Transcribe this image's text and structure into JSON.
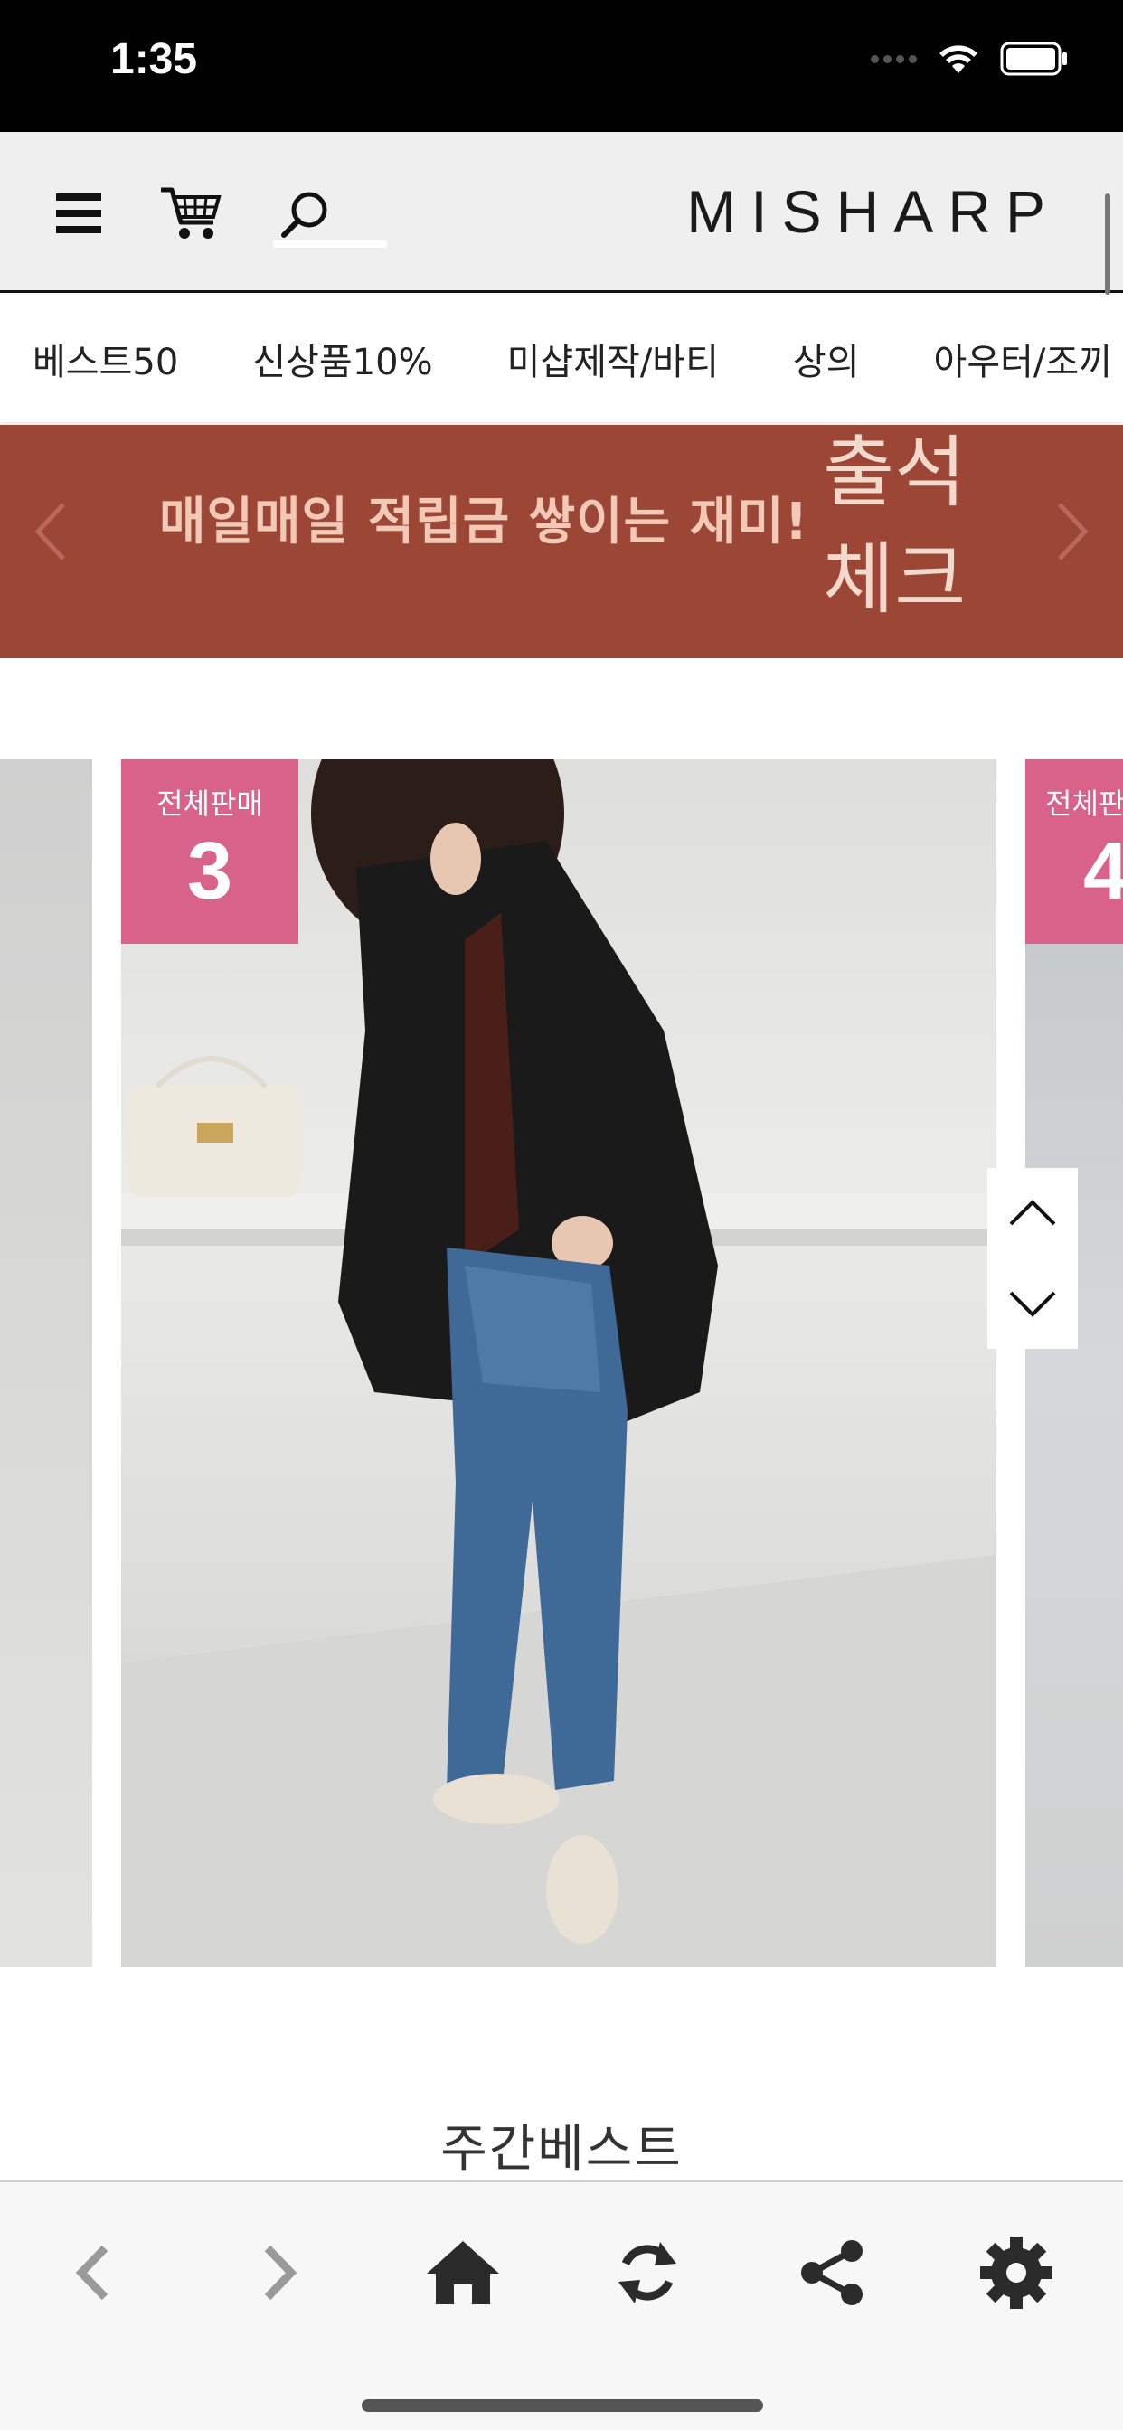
{
  "status_bar": {
    "time": "1:35"
  },
  "header": {
    "logo": "MISHARP"
  },
  "categories": [
    "베스트50",
    "신상품10%",
    "미샵제작/바티",
    "상의",
    "아우터/조끼"
  ],
  "banner": {
    "text": "매일매일 적립금 쌓이는 재미!",
    "side_line1": "출석",
    "side_line2": "체크",
    "color": "#9c4636"
  },
  "products": {
    "main_badge": {
      "label": "전체판매",
      "rank": "3"
    },
    "next_badge": {
      "label": "전체판",
      "rank": "4"
    },
    "badge_color": "#d9628a"
  },
  "section": {
    "title": "주간베스트"
  },
  "toolbar": {
    "items": [
      "back-icon",
      "forward-icon",
      "home-icon",
      "refresh-icon",
      "share-icon",
      "settings-icon"
    ]
  }
}
